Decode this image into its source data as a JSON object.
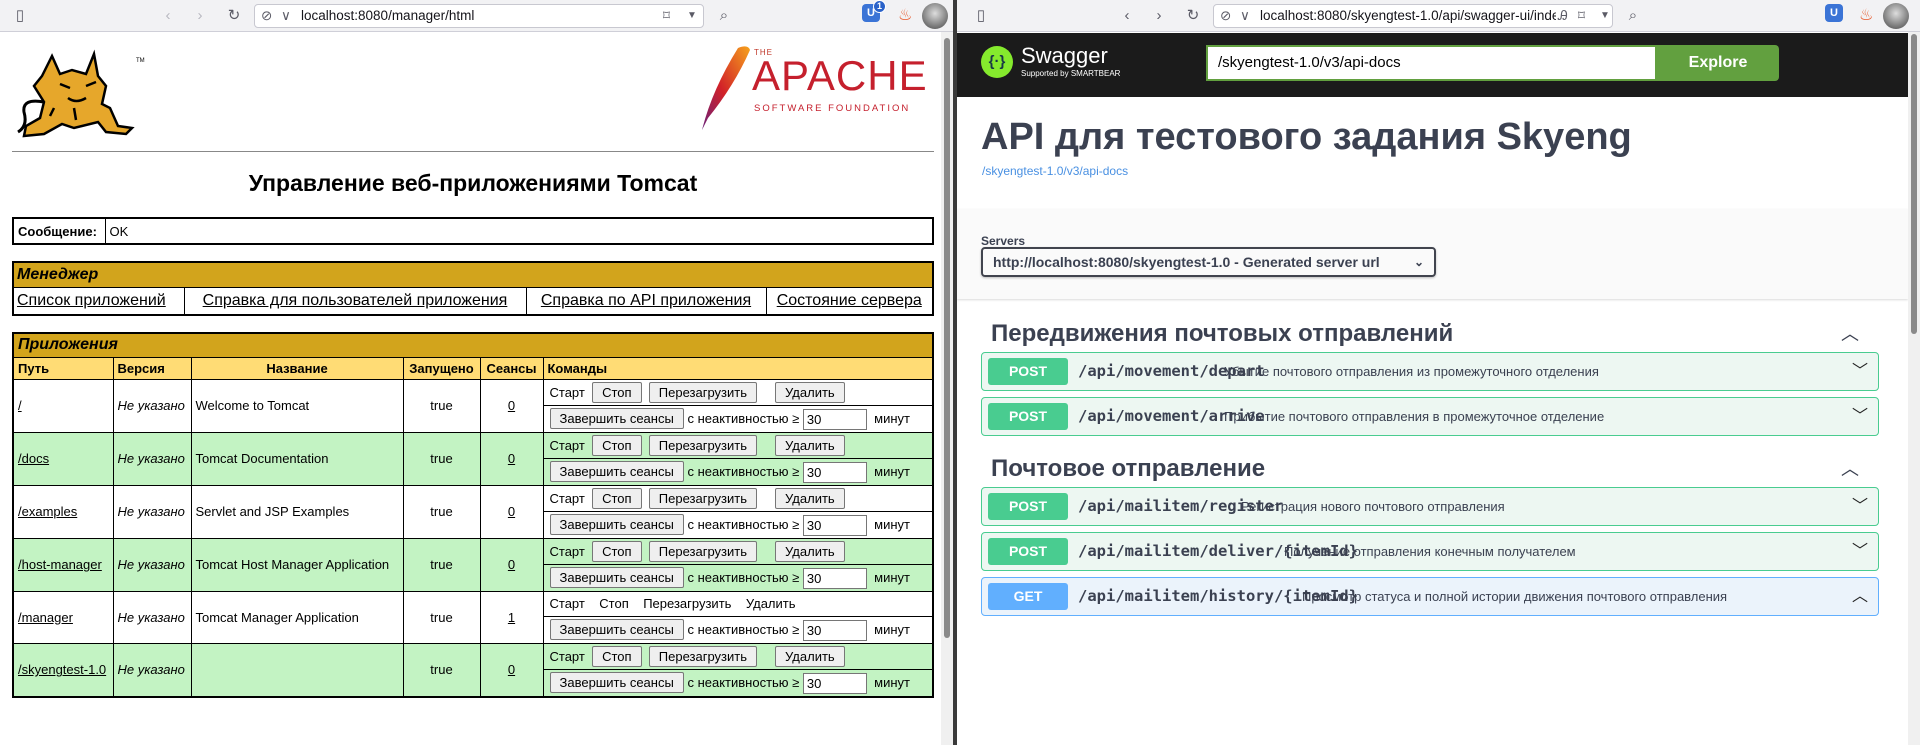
{
  "left": {
    "url": "localhost:8080/manager/html",
    "badge_count": "1",
    "title": "Управление веб-приложениями Tomcat",
    "message_label": "Сообщение:",
    "message_value": "OK",
    "manager_header": "Менеджер",
    "manager_links": [
      "Список приложений",
      "Справка для пользователей приложения",
      "Справка по API приложения",
      "Состояние сервера"
    ],
    "apps_header": "Приложения",
    "columns": [
      "Путь",
      "Версия",
      "Название",
      "Запущено",
      "Сеансы",
      "Команды"
    ],
    "apps": [
      {
        "path": "/",
        "version": "Не указано",
        "name": "Welcome to Tomcat",
        "running": "true",
        "sessions": "0"
      },
      {
        "path": "/docs",
        "version": "Не указано",
        "name": "Tomcat Documentation",
        "running": "true",
        "sessions": "0"
      },
      {
        "path": "/examples",
        "version": "Не указано",
        "name": "Servlet and JSP Examples",
        "running": "true",
        "sessions": "0"
      },
      {
        "path": "/host-manager",
        "version": "Не указано",
        "name": "Tomcat Host Manager Application",
        "running": "true",
        "sessions": "0"
      },
      {
        "path": "/manager",
        "version": "Не указано",
        "name": "Tomcat Manager Application",
        "running": "true",
        "sessions": "1"
      },
      {
        "path": "/skyengtest-1.0",
        "version": "Не указано",
        "name": "",
        "running": "true",
        "sessions": "0"
      }
    ],
    "cmd": {
      "start": "Старт",
      "stop": "Стоп",
      "reload": "Перезагрузить",
      "undeploy": "Удалить",
      "expire": "Завершить сеансы",
      "inactivity": "с неактивностью ≥",
      "minutes_value": "30",
      "minutes": "минут"
    },
    "apache": {
      "the": "THE",
      "name": "APACHE",
      "sub": "SOFTWARE FOUNDATION"
    }
  },
  "right": {
    "url": "localhost:8080/skyengtest-1.0/api/swagger-ui/index.html",
    "brand": "Swagger",
    "brand_sub": "Supported by SMARTBEAR",
    "spec_url": "/skyengtest-1.0/v3/api-docs",
    "explore": "Explore",
    "title": "API для тестового задания Skyeng",
    "spec_link": "/skyengtest-1.0/v3/api-docs",
    "servers_label": "Servers",
    "server": "http://localhost:8080/skyengtest-1.0 - Generated server url",
    "tags": [
      {
        "name": "Передвижения почтовых отправлений",
        "ops": [
          {
            "method": "POST",
            "path": "/api/movement/depart",
            "desc": "Убытие почтового отправления из промежуточного отделения"
          },
          {
            "method": "POST",
            "path": "/api/movement/arrive",
            "desc": "Прибытие почтового отправления в промежуточное отделение"
          }
        ]
      },
      {
        "name": "Почтовое отправление",
        "ops": [
          {
            "method": "POST",
            "path": "/api/mailitem/register",
            "desc": "Регистрация нового почтового отправления"
          },
          {
            "method": "POST",
            "path": "/api/mailitem/deliver/{itemId}",
            "desc": "Получение отправления конечным получателем"
          },
          {
            "method": "GET",
            "path": "/api/mailitem/history/{itemId}",
            "desc": "Просмотр статуса и полной истории движения почтового отправления"
          }
        ]
      }
    ]
  }
}
